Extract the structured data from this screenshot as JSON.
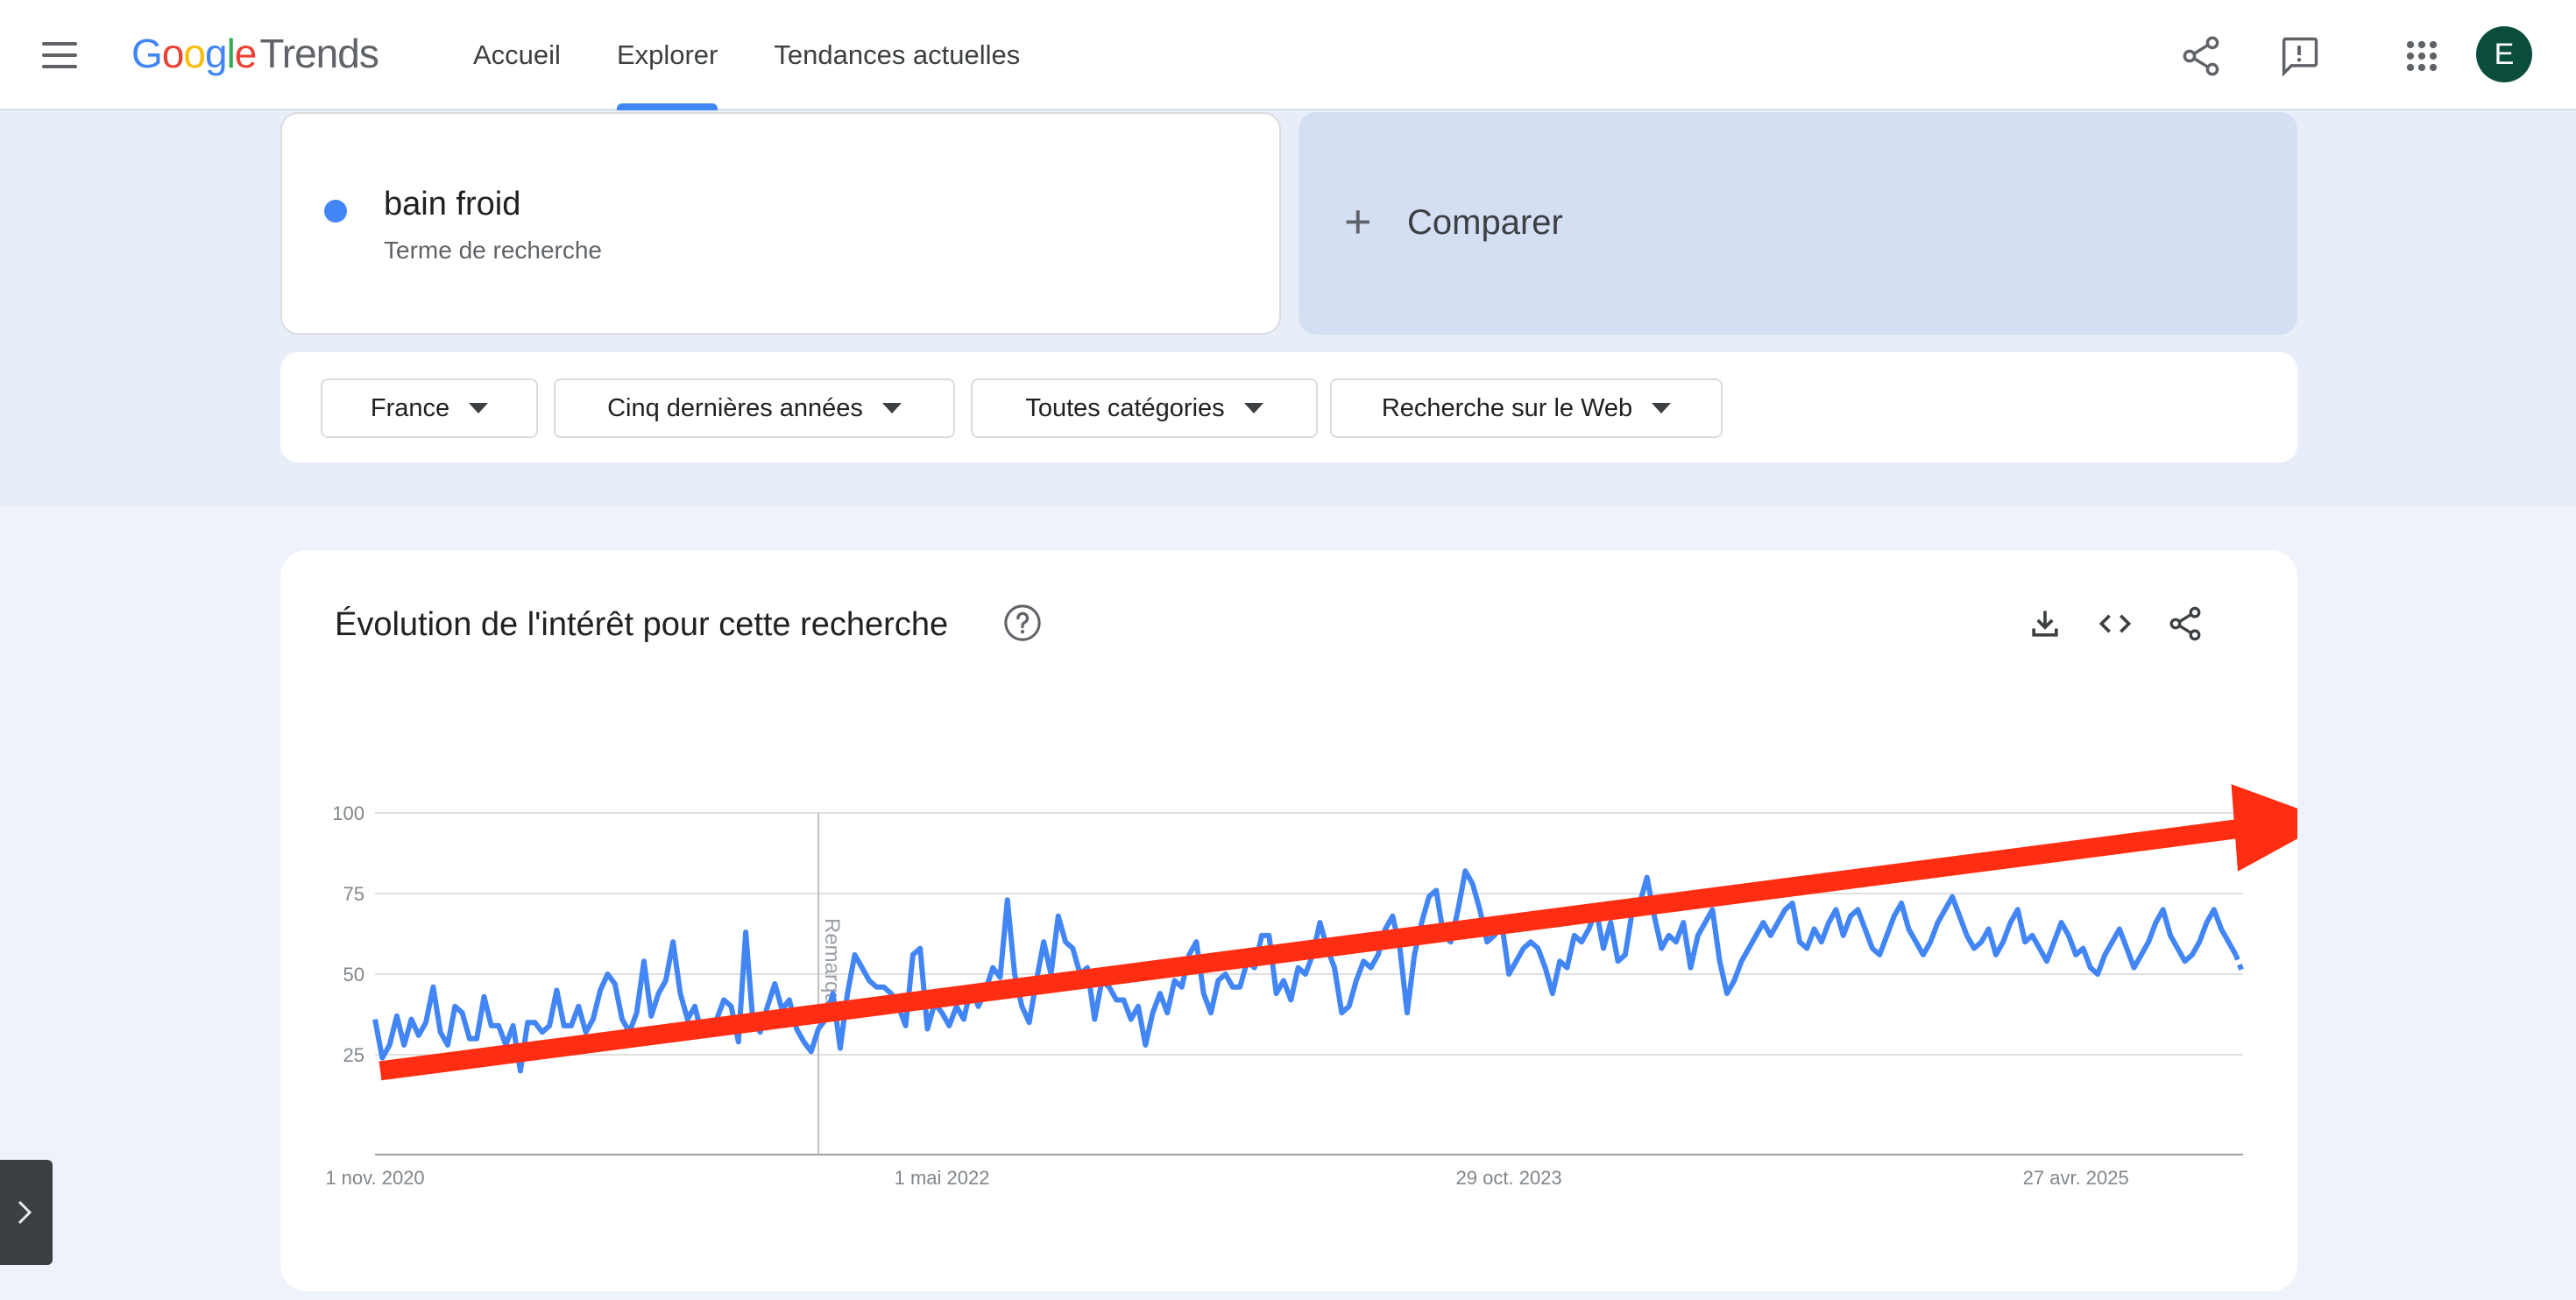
{
  "header": {
    "logo_google": "Google",
    "logo_trends": "Trends",
    "nav": [
      {
        "label": "Accueil",
        "active": false
      },
      {
        "label": "Explorer",
        "active": true
      },
      {
        "label": "Tendances actuelles",
        "active": false
      }
    ],
    "avatar_letter": "E",
    "icons": [
      "menu-icon",
      "share-icon",
      "feedback-icon",
      "apps-grid-icon"
    ]
  },
  "search": {
    "term": "bain froid",
    "term_type": "Terme de recherche",
    "term_color": "#4285f4",
    "compare_label": "Comparer"
  },
  "filters": {
    "region": "France",
    "period": "Cinq dernières années",
    "category": "Toutes catégories",
    "source": "Recherche sur le Web"
  },
  "interest_card": {
    "title": "Évolution de l'intérêt pour cette recherche",
    "icons": [
      "help-icon",
      "download-icon",
      "embed-code-icon",
      "share-icon"
    ]
  },
  "chart_data": {
    "type": "line",
    "title": "Évolution de l'intérêt pour cette recherche",
    "y_ticks": [
      25,
      50,
      75,
      100
    ],
    "ylim": [
      0,
      100
    ],
    "x_ticks": [
      {
        "label": "1 nov. 2020",
        "index": 0
      },
      {
        "label": "1 mai 2022",
        "index": 78
      },
      {
        "label": "29 oct. 2023",
        "index": 156
      },
      {
        "label": "27 avr. 2025",
        "index": 234
      }
    ],
    "note_label": "Remarque",
    "note_index": 61,
    "grid": true,
    "series": [
      {
        "color": "#4285f4",
        "values": [
          36,
          24,
          28,
          37,
          28,
          36,
          31,
          35,
          46,
          32,
          28,
          40,
          38,
          30,
          30,
          43,
          34,
          34,
          28,
          34,
          20,
          35,
          35,
          32,
          34,
          45,
          34,
          34,
          40,
          32,
          36,
          45,
          50,
          47,
          36,
          32,
          38,
          54,
          37,
          44,
          48,
          60,
          44,
          36,
          40,
          31,
          34,
          36,
          42,
          40,
          29,
          63,
          35,
          32,
          40,
          47,
          39,
          42,
          33,
          29,
          26,
          33,
          36,
          44,
          27,
          44,
          56,
          52,
          48,
          46,
          46,
          44,
          40,
          34,
          56,
          58,
          33,
          41,
          38,
          34,
          40,
          36,
          46,
          40,
          45,
          52,
          49,
          73,
          50,
          40,
          35,
          48,
          60,
          50,
          68,
          60,
          58,
          50,
          52,
          36,
          48,
          46,
          42,
          42,
          36,
          40,
          28,
          38,
          44,
          38,
          48,
          46,
          56,
          60,
          44,
          38,
          48,
          50,
          46,
          46,
          54,
          52,
          62,
          62,
          44,
          48,
          42,
          52,
          50,
          56,
          66,
          58,
          52,
          38,
          40,
          48,
          54,
          52,
          56,
          64,
          68,
          58,
          38,
          56,
          66,
          74,
          76,
          62,
          60,
          70,
          82,
          78,
          70,
          60,
          62,
          66,
          50,
          54,
          58,
          60,
          58,
          52,
          44,
          54,
          52,
          62,
          60,
          64,
          70,
          58,
          66,
          54,
          56,
          70,
          72,
          80,
          68,
          58,
          62,
          60,
          66,
          52,
          62,
          66,
          70,
          54,
          44,
          48,
          54,
          58,
          62,
          66,
          62,
          66,
          70,
          72,
          60,
          58,
          64,
          60,
          66,
          70,
          62,
          68,
          70,
          64,
          58,
          56,
          62,
          68,
          72,
          64,
          60,
          56,
          60,
          66,
          70,
          74,
          68,
          62,
          58,
          60,
          64,
          56,
          60,
          66,
          70,
          60,
          62,
          58,
          54,
          60,
          66,
          62,
          56,
          58,
          52,
          50,
          56,
          60,
          64,
          58,
          52,
          56,
          60,
          66,
          70,
          62,
          58,
          54,
          56,
          60,
          66,
          70,
          64,
          60,
          56,
          50
        ]
      }
    ],
    "overlay_arrow": {
      "color": "#ff2d12",
      "from_index": 0,
      "to_index": 300,
      "from_value": 20,
      "to_value": 96
    }
  }
}
